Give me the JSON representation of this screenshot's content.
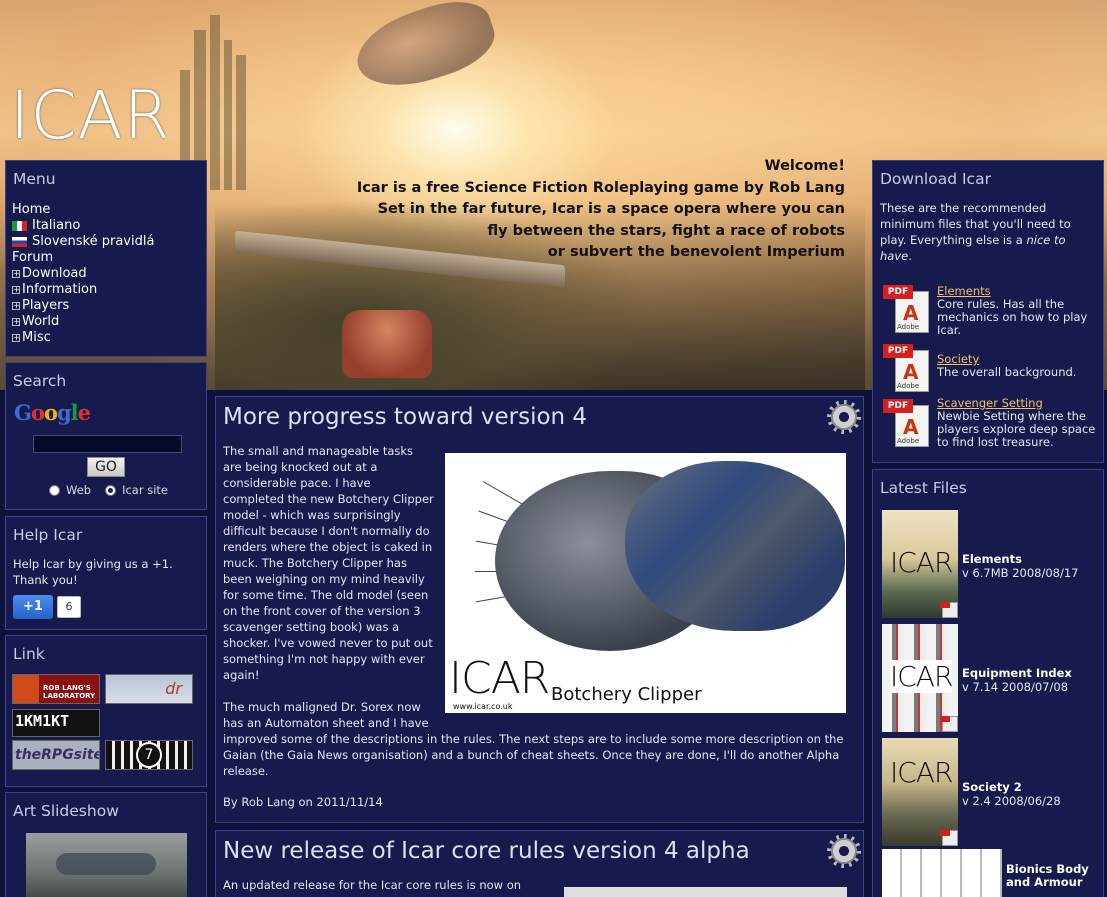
{
  "site": {
    "logo": "ICAR",
    "welcome_lines": [
      "Welcome!",
      "Icar is a free Science Fiction Roleplaying game by Rob Lang",
      "Set in the far future, Icar is a space opera where you can",
      "fly between the stars, fight a race of robots",
      "or subvert the benevolent Imperium"
    ]
  },
  "menu": {
    "title": "Menu",
    "items": [
      {
        "label": "Home"
      },
      {
        "label": "Italiano",
        "flag": "italy-flag-icon"
      },
      {
        "label": "Slovenské pravidlá",
        "flag": "slovakia-flag-icon"
      },
      {
        "label": "Forum"
      },
      {
        "label": "Download",
        "expand": "plus-icon"
      },
      {
        "label": "Information",
        "expand": "plus-icon"
      },
      {
        "label": "Players",
        "expand": "plus-icon"
      },
      {
        "label": "World",
        "expand": "plus-icon"
      },
      {
        "label": "Misc",
        "expand": "plus-icon"
      }
    ]
  },
  "search": {
    "title": "Search",
    "logo_text": "Google",
    "input_value": "",
    "go_label": "GO",
    "options": [
      {
        "label": "Web",
        "selected": false
      },
      {
        "label": "Icar site",
        "selected": true
      }
    ]
  },
  "help": {
    "title": "Help Icar",
    "text": "Help Icar by giving us a +1. Thank you!",
    "plusone_label": "+1",
    "plusone_count": "6"
  },
  "links": {
    "title": "Link",
    "items": [
      "ROB LANG'S LABORATORY",
      "dr",
      "1KM1KT",
      "theRPGsite",
      "7"
    ]
  },
  "slideshow": {
    "title": "Art Slideshow"
  },
  "post": {
    "title": "More progress toward version 4",
    "paragraph1": "The small and manageable tasks are being knocked out at a considerable pace. I have completed the new Botchery Clipper model - which was surprisingly difficult because I don't normally do renders where the object is caked in muck. The Botchery Clipper has been weighing on my mind heavily for some time. The old model (seen on the front cover of the version 3 scavenger setting book) was a shocker. I've vowed never to put out something I'm not happy with ever again!",
    "paragraph2": "The much maligned Dr. Sorex now has an Automaton sheet and I have improved some of the descriptions in the rules. The next steps are to include some more description on the Gaian (the Gaia News organisation) and a bunch of cheat sheets. Once they are done, I'll do another Alpha release.",
    "image_logo": "ICAR",
    "image_url": "www.icar.co.uk",
    "image_caption": "Botchery Clipper",
    "author": "By Rob Lang on 2011/11/14"
  },
  "post2": {
    "title": "New release of Icar core rules version 4 alpha",
    "intro": "An updated release for the Icar core rules is now on"
  },
  "download": {
    "title": "Download Icar",
    "intro_before": "These are the recommended minimum files that you'll need to play. Everything else is a ",
    "intro_em": "nice to have",
    "intro_after": ".",
    "items": [
      {
        "name": "Elements",
        "desc": "Core rules. Has all the mechanics on how to play Icar."
      },
      {
        "name": "Society",
        "desc": "The overall background."
      },
      {
        "name": "Scavenger Setting",
        "desc": "Newbie Setting where the players explore deep space to find lost treasure."
      }
    ],
    "pdf_tag": "PDF",
    "adobe_label": "Adobe"
  },
  "latest": {
    "title": "Latest Files",
    "items": [
      {
        "name": "Elements",
        "meta": "v 6.7MB 2008/08/17",
        "cover": "ICAR"
      },
      {
        "name": "Equipment Index",
        "meta": "v 7.14 2008/07/08",
        "cover": "ICAR"
      },
      {
        "name": "Society 2",
        "meta": "v 2.4 2008/06/28",
        "cover": "ICAR"
      },
      {
        "name": "Bionics Body and Armour",
        "meta": "",
        "cover": ""
      }
    ]
  }
}
